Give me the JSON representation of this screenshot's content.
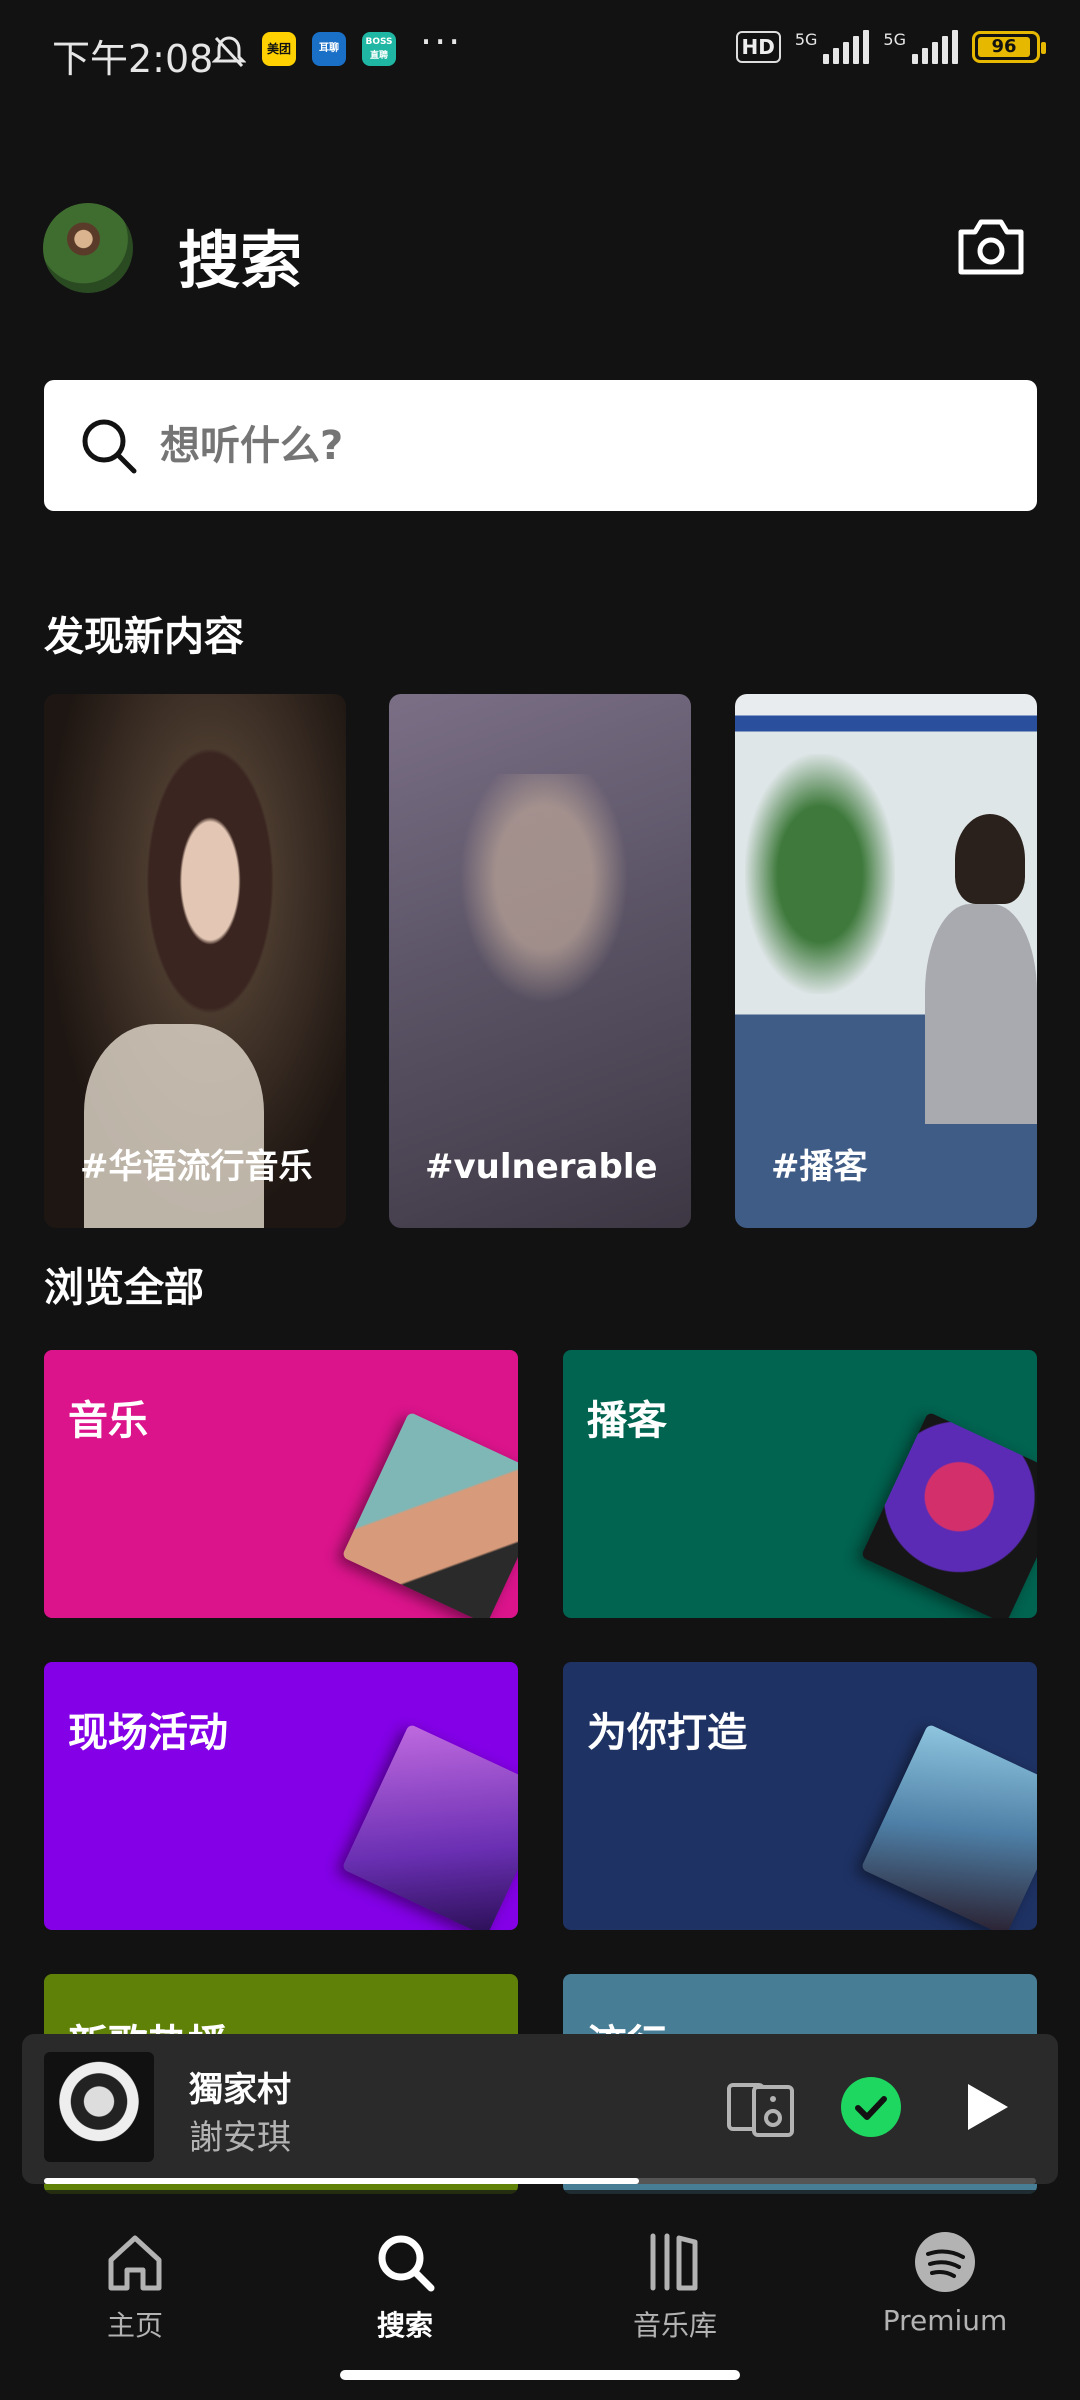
{
  "status_bar": {
    "time": "下午2:08",
    "icon_meituan": "美团",
    "icon_zhaopin": "BOSS直聘",
    "battery": "96",
    "hd": "HD",
    "net1": "5G",
    "net2": "5G"
  },
  "header": {
    "title": "搜索"
  },
  "search": {
    "placeholder": "想听什么?"
  },
  "discover": {
    "title": "发现新内容",
    "cards": [
      {
        "tag": "#华语流行音乐"
      },
      {
        "tag": "#vulnerable"
      },
      {
        "tag": "#播客"
      }
    ]
  },
  "browse": {
    "title": "浏览全部",
    "tiles": [
      {
        "label": "音乐",
        "color": "#dc148c"
      },
      {
        "label": "播客",
        "color": "#006450"
      },
      {
        "label": "现场活动",
        "color": "#8400e7"
      },
      {
        "label": "为你打造",
        "color": "#1e3264"
      },
      {
        "label": "新歌热播",
        "color": "#608108"
      },
      {
        "label": "流行",
        "color": "#477d95"
      }
    ]
  },
  "player": {
    "title": "獨家村",
    "artist": "謝安琪",
    "progress": 0.6,
    "accent": "#1ed760"
  },
  "nav": {
    "items": [
      {
        "label": "主页",
        "icon": "home-icon"
      },
      {
        "label": "搜索",
        "icon": "search-icon"
      },
      {
        "label": "音乐库",
        "icon": "library-icon"
      },
      {
        "label": "Premium",
        "icon": "spotify-icon"
      }
    ]
  }
}
